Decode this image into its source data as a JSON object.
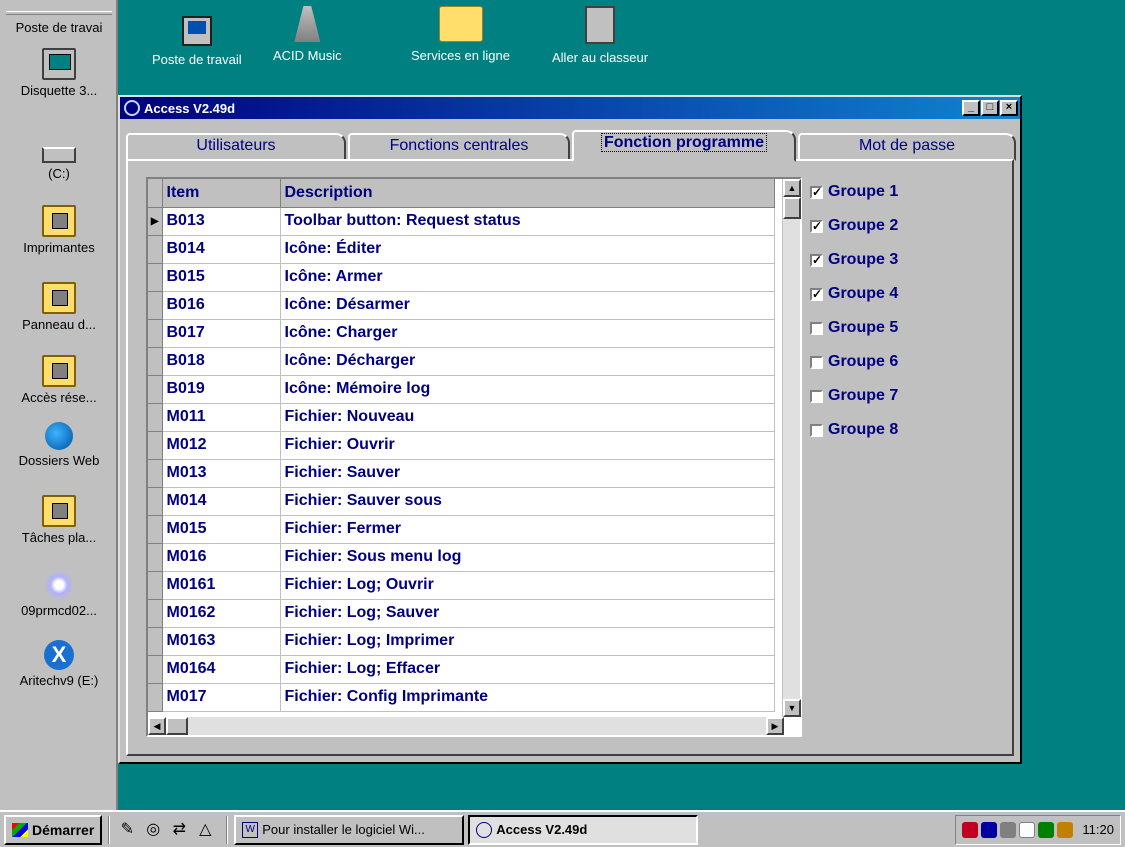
{
  "desktop": {
    "sidebar_items": [
      {
        "label": "Poste de travai",
        "icon": "computer-icon"
      },
      {
        "label": "Disquette 3...",
        "icon": "floppy-icon"
      },
      {
        "label": "(C:)",
        "icon": "drive-icon"
      },
      {
        "label": "Imprimantes",
        "icon": "printer-folder-icon"
      },
      {
        "label": "Panneau d...",
        "icon": "control-panel-icon"
      },
      {
        "label": "Accès rése...",
        "icon": "network-folder-icon"
      },
      {
        "label": "Dossiers Web",
        "icon": "web-folder-icon"
      },
      {
        "label": "Tâches pla...",
        "icon": "scheduled-tasks-icon"
      },
      {
        "label": "09prmcd02...",
        "icon": "cd-icon"
      },
      {
        "label": "Aritechv9 (E:)",
        "icon": "cd-drive-icon"
      }
    ],
    "top_icons": [
      {
        "label": "Poste de travail",
        "icon": "computer-icon"
      },
      {
        "label": "ACID Music",
        "icon": "metronome-icon"
      },
      {
        "label": "Services en ligne",
        "icon": "folder-icon"
      },
      {
        "label": "Aller au classeur",
        "icon": "cabinet-icon"
      }
    ]
  },
  "window": {
    "title": "Access V2.49d",
    "tabs": [
      {
        "label": "Utilisateurs",
        "active": false
      },
      {
        "label": "Fonctions centrales",
        "active": false
      },
      {
        "label": "Fonction programme",
        "active": true
      },
      {
        "label": "Mot de passe",
        "active": false
      }
    ],
    "grid": {
      "headers": {
        "item": "Item",
        "description": "Description"
      },
      "current_row_marker": "▶",
      "rows": [
        {
          "item": "B013",
          "description": "Toolbar button: Request status"
        },
        {
          "item": "B014",
          "description": "Icône: Éditer"
        },
        {
          "item": "B015",
          "description": "Icône: Armer"
        },
        {
          "item": "B016",
          "description": "Icône: Désarmer"
        },
        {
          "item": "B017",
          "description": "Icône: Charger"
        },
        {
          "item": "B018",
          "description": "Icône: Décharger"
        },
        {
          "item": "B019",
          "description": "Icône: Mémoire log"
        },
        {
          "item": "M011",
          "description": "Fichier: Nouveau"
        },
        {
          "item": "M012",
          "description": "Fichier: Ouvrir"
        },
        {
          "item": "M013",
          "description": "Fichier: Sauver"
        },
        {
          "item": "M014",
          "description": "Fichier: Sauver sous"
        },
        {
          "item": "M015",
          "description": "Fichier: Fermer"
        },
        {
          "item": "M016",
          "description": "Fichier: Sous menu log"
        },
        {
          "item": "M0161",
          "description": "Fichier: Log; Ouvrir"
        },
        {
          "item": "M0162",
          "description": "Fichier: Log; Sauver"
        },
        {
          "item": "M0163",
          "description": "Fichier: Log; Imprimer"
        },
        {
          "item": "M0164",
          "description": "Fichier: Log; Effacer"
        },
        {
          "item": "M017",
          "description": "Fichier: Config Imprimante"
        }
      ]
    },
    "groups": [
      {
        "label": "Groupe 1",
        "checked": true
      },
      {
        "label": "Groupe 2",
        "checked": true
      },
      {
        "label": "Groupe 3",
        "checked": true
      },
      {
        "label": "Groupe 4",
        "checked": true
      },
      {
        "label": "Groupe 5",
        "checked": false
      },
      {
        "label": "Groupe 6",
        "checked": false
      },
      {
        "label": "Groupe 7",
        "checked": false
      },
      {
        "label": "Groupe 8",
        "checked": false
      }
    ]
  },
  "taskbar": {
    "start_label": "Démarrer",
    "tasks": [
      {
        "label": "Pour installer le logiciel Wi...",
        "active": false,
        "icon": "word-document-icon"
      },
      {
        "label": "Access V2.49d",
        "active": true,
        "icon": "access-app-icon"
      }
    ],
    "clock": "11:20"
  }
}
